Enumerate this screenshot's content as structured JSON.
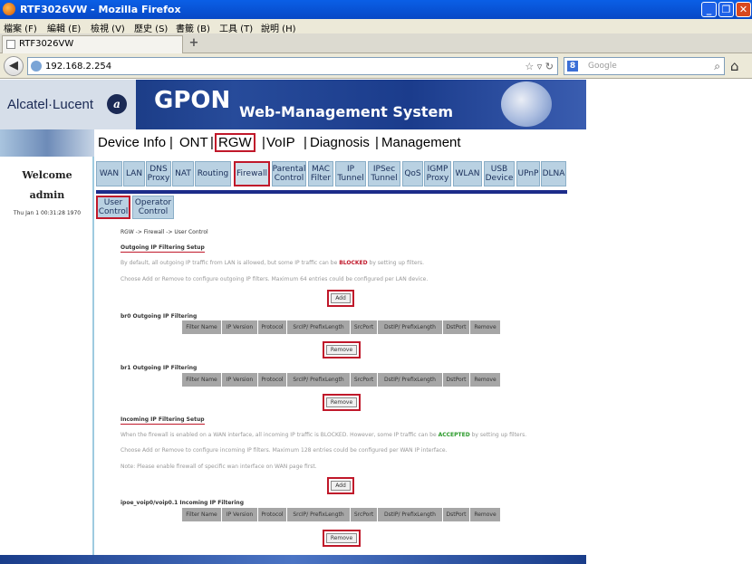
{
  "browser": {
    "window_title": "RTF3026VW - Mozilla Firefox",
    "menu": [
      "檔案 (F)",
      "編輯 (E)",
      "檢視 (V)",
      "歷史 (S)",
      "書籤 (B)",
      "工具 (T)",
      "說明 (H)"
    ],
    "tab_title": "RTF3026VW",
    "url": "192.168.2.254",
    "search_placeholder": "Google",
    "search_engine_letter": "8"
  },
  "header": {
    "brand": "Alcatel·Lucent",
    "product": "GPON",
    "subtitle": "Web-Management System"
  },
  "sidebar": {
    "welcome": "Welcome",
    "user": "admin",
    "datetime": "Thu Jan 1 00:31:28 1970"
  },
  "topnav": {
    "items": [
      "Device Info",
      "ONT",
      "RGW",
      "VoIP",
      "Diagnosis",
      "Management"
    ],
    "sep": "|",
    "active": "RGW"
  },
  "subtabs": {
    "items": [
      "WAN",
      "LAN",
      "DNS Proxy",
      "NAT",
      "Routing",
      "Firewall",
      "Parental Control",
      "MAC Filter",
      "IP Tunnel",
      "IPSec Tunnel",
      "QoS",
      "IGMP Proxy",
      "WLAN",
      "USB Device",
      "UPnP",
      "DLNA"
    ],
    "active": "Firewall"
  },
  "subsubtabs": {
    "items": [
      "User Control",
      "Operator Control"
    ],
    "active": "User Control"
  },
  "page": {
    "breadcrumb": "RGW -> Firewall -> User Control",
    "outgoing": {
      "title": "Outgoing IP Filtering Setup",
      "desc1_pre": "By default, all outgoing IP traffic from LAN is allowed, but some IP traffic can be",
      "desc1_strong": "BLOCKED",
      "desc1_post": "by setting up filters.",
      "desc2": "Choose Add or Remove to configure outgoing IP filters. Maximum 64 entries could be configured per LAN device.",
      "add_label": "Add",
      "br0_title": "br0 Outgoing IP Filtering",
      "br1_title": "br1 Outgoing IP Filtering",
      "remove_label": "Remove"
    },
    "incoming": {
      "title": "Incoming IP Filtering Setup",
      "desc1_pre": "When the firewall is enabled on a WAN interface, all incoming IP traffic is BLOCKED. However, some IP traffic can be",
      "desc1_strong": "ACCEPTED",
      "desc1_post": "by setting up filters.",
      "desc2": "Choose Add or Remove to configure incoming IP filters. Maximum 128 entries could be configured per WAN IP interface.",
      "note": "Note: Please enable firewall of specific wan interface on WAN page first.",
      "add_label": "Add",
      "ipoe_title": "ipoe_voip0/voip0.1 Incoming IP Filtering",
      "remove_label": "Remove"
    },
    "table_headers": [
      "Filter Name",
      "IP Version",
      "Protocol",
      "SrcIP/ PrefixLength",
      "SrcPort",
      "DstIP/ PrefixLength",
      "DstPort",
      "Remove"
    ]
  }
}
